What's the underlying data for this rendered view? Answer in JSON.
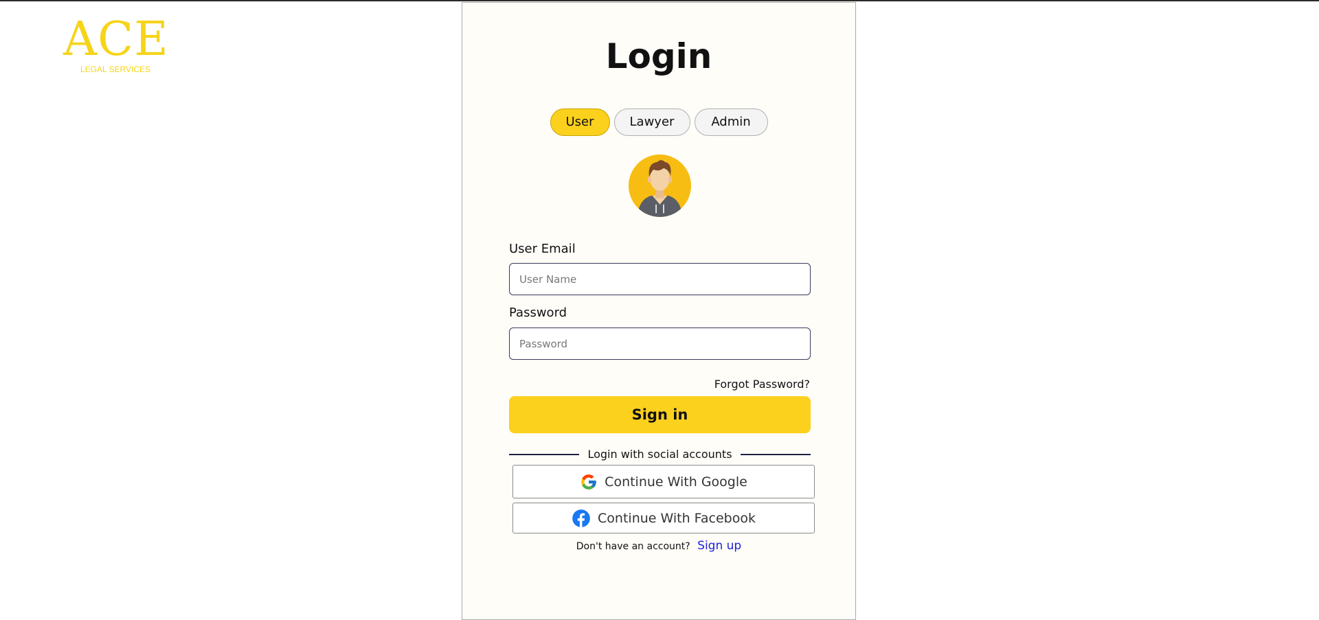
{
  "logo": {
    "main": "ACE",
    "sub": "LEGAL SERVICES"
  },
  "login": {
    "title": "Login",
    "roles": [
      {
        "label": "User",
        "active": true
      },
      {
        "label": "Lawyer",
        "active": false
      },
      {
        "label": "Admin",
        "active": false
      }
    ],
    "email_label": "User Email",
    "email_placeholder": "User Name",
    "email_value": "",
    "password_label": "Password",
    "password_placeholder": "Password",
    "password_value": "",
    "forgot_password": "Forgot Password?",
    "signin_label": "Sign in",
    "social_divider": "Login with social accounts",
    "google_label": "Continue With Google",
    "facebook_label": "Continue With Facebook",
    "no_account_text": "Don't have an account?",
    "signup_label": "Sign up"
  },
  "icons": {
    "avatar": "user-avatar-icon",
    "google": "google-icon",
    "facebook": "facebook-icon"
  },
  "colors": {
    "accent": "#fcd11d",
    "logo": "#f5d41a",
    "link": "#1d1ddb",
    "facebook": "#1877f2",
    "divider": "#1d2145"
  }
}
